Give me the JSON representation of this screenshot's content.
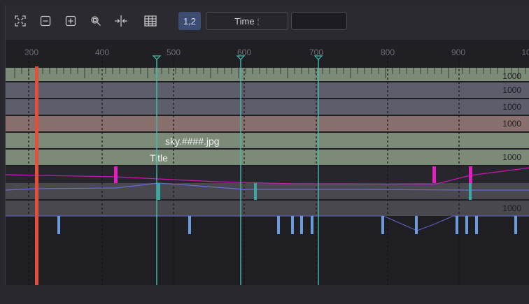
{
  "toolbar": {
    "icons": [
      "fit-icon",
      "zoom-out-icon",
      "zoom-in-icon",
      "zoom-rect-icon",
      "split-icon",
      "grid-icon"
    ],
    "version_button": "1,2",
    "time_label": "Time :",
    "time_value": ""
  },
  "axis": {
    "ticks": [
      "300",
      "400",
      "500",
      "600",
      "700",
      "800",
      "900",
      "10"
    ]
  },
  "tracks": {
    "row_values": [
      "1000",
      "1000",
      "1000",
      "1000",
      "1000",
      "1000"
    ],
    "clip_sky": "sky.####.jpg",
    "clip_title": "Title"
  },
  "colors": {
    "playhead": "#e0503a",
    "marker": "#3dbfb0",
    "keyframe_magenta": "#e020c0",
    "keyframe_blue": "#6a9cde",
    "track_green": "#7c8a78",
    "track_blue_grey": "#5c5e6c",
    "track_rose": "#8a706c"
  }
}
